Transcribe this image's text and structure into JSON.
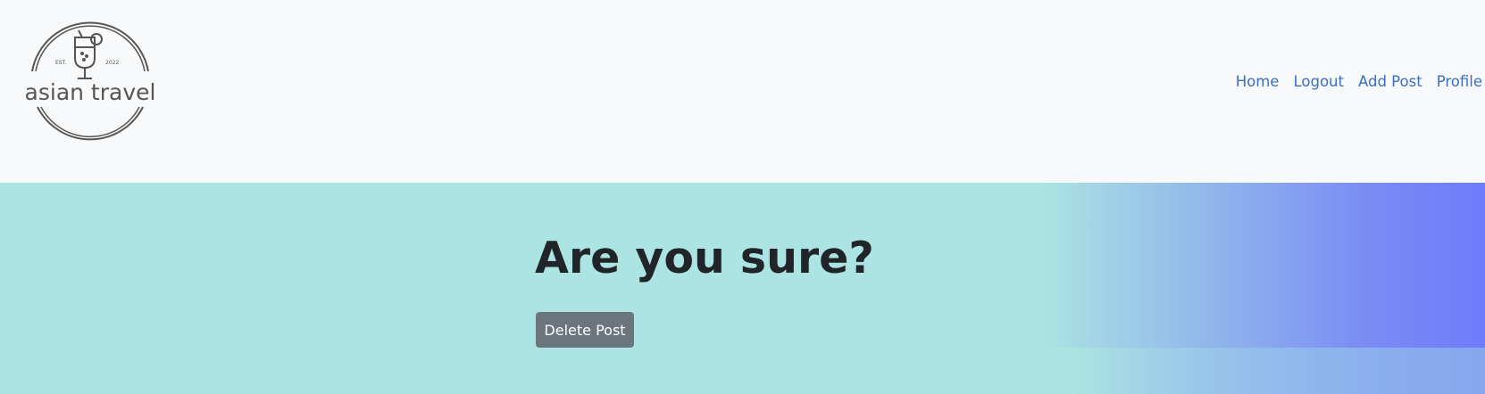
{
  "logo": {
    "est": "EST.",
    "year": "2022",
    "name": "asian travel"
  },
  "nav": {
    "links": [
      "Home",
      "Logout",
      "Add Post",
      "Profile"
    ]
  },
  "main": {
    "heading": "Are you sure?",
    "delete_button_label": "Delete Post"
  },
  "colors": {
    "navbar_bg": "#f8f9fa",
    "link": "#3a6fc4",
    "main_bg": "#abe4e2",
    "gradient_end": "#6e7cfb",
    "button_bg": "#6c757d",
    "heading": "#212529"
  }
}
